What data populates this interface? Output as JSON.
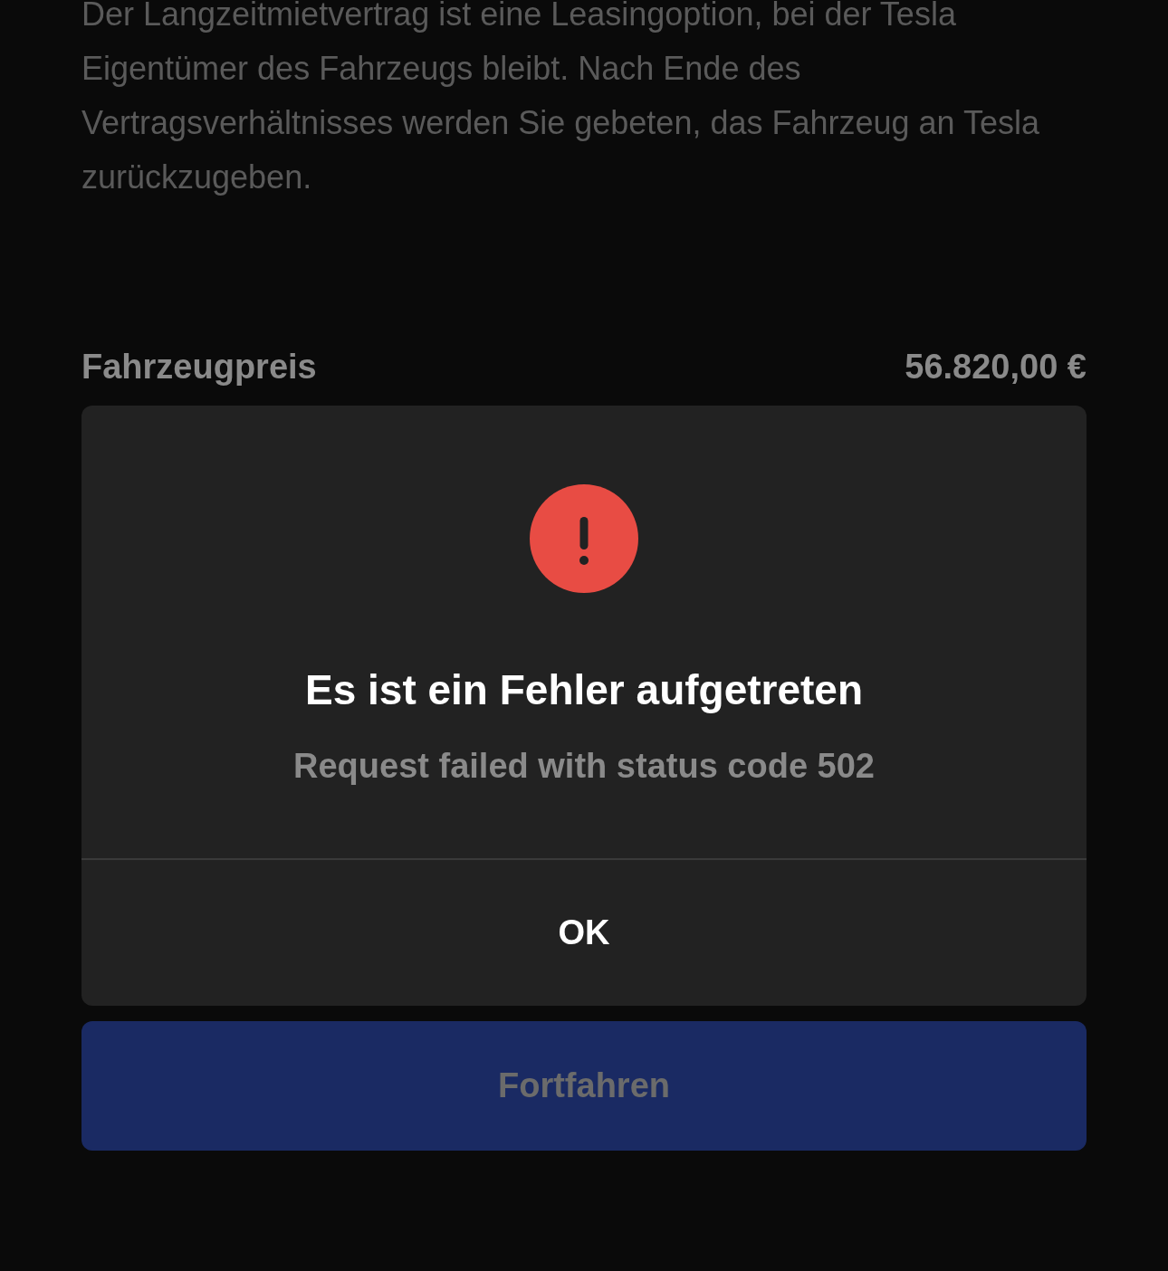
{
  "description": "Der Langzeitmietvertrag ist eine Leasingoption, bei der Tesla Eigentümer des Fahrzeugs bleibt. Nach Ende des Vertragsverhältnisses werden Sie gebeten, das Fahrzeug an Tesla zurückzugeben.",
  "price_row": {
    "label": "Fahrzeugpreis",
    "value": "56.820,00 €"
  },
  "dialog": {
    "title": "Es ist ein Fehler aufgetreten",
    "message": "Request failed with status code 502",
    "button": "OK"
  },
  "continue_button": {
    "label": "Fortfahren",
    "disabled": true
  }
}
